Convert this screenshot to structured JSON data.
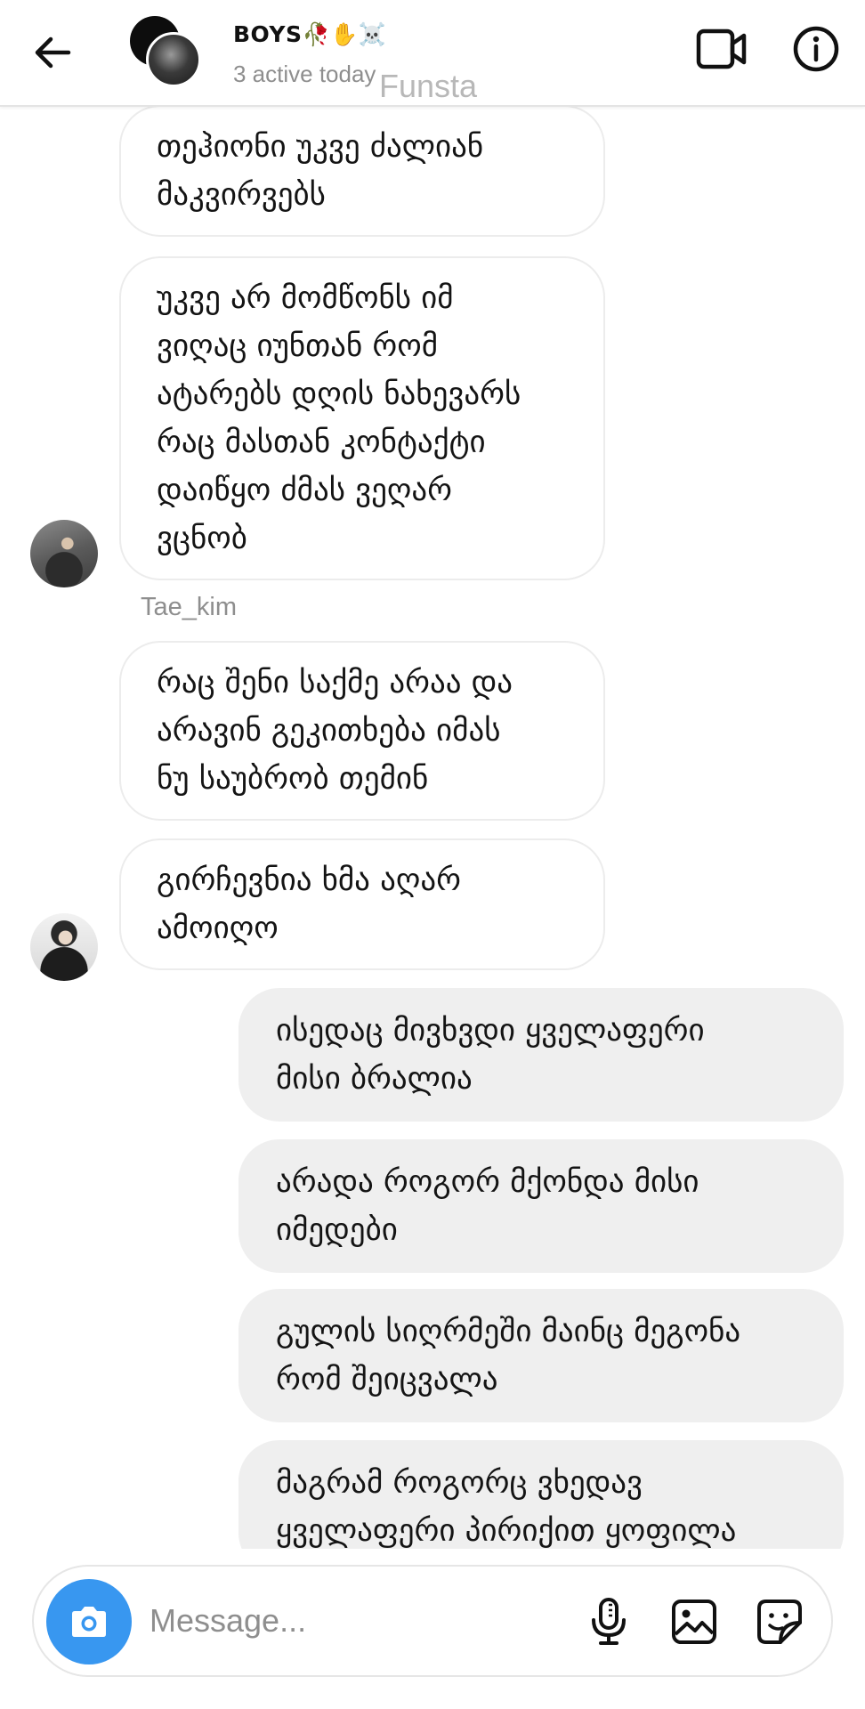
{
  "header": {
    "back_icon": "arrow-left-icon",
    "title": "BOYS🥀✋☠️",
    "status": "3 active today",
    "video_icon": "video-camera-icon",
    "info_icon": "info-icon"
  },
  "watermark": "Funsta",
  "thread": {
    "incoming": [
      {
        "text": "თეჰიონი უკვე ძალიან\nმაკვირვებს"
      },
      {
        "text": "უკვე არ მომწონს იმ\nვიღაც იუნთან რომ\nატარებს დღის ნახევარს\nრაც მასთან კონტაქტი\nდაიწყო ძმას ვეღარ\nვცნობ"
      },
      {
        "text": "რაც შენი საქმე არაა და\nარავინ გეკითხება იმას\nნუ საუბრობ თემინ"
      },
      {
        "text": "გირჩევნია ხმა აღარ\nამოიღო"
      }
    ],
    "sender_name": "Tae_kim",
    "outgoing": [
      {
        "text": "ისედაც მივხვდი ყველაფერი\nმისი ბრალია"
      },
      {
        "text": "არადა როგორ მქონდა მისი\nიმედები"
      },
      {
        "text": "გულის სიღრმეში მაინც მეგონა\nრომ შეიცვალა"
      },
      {
        "text": "მაგრამ როგორც ვხედავ\nყველაფერი პირიქით ყოფილა"
      }
    ]
  },
  "composer": {
    "placeholder": "Message...",
    "value": "",
    "camera_icon": "camera-icon",
    "mic_icon": "microphone-icon",
    "gallery_icon": "image-gallery-icon",
    "sticker_icon": "sticker-icon",
    "accent_color": "#3897f0"
  }
}
